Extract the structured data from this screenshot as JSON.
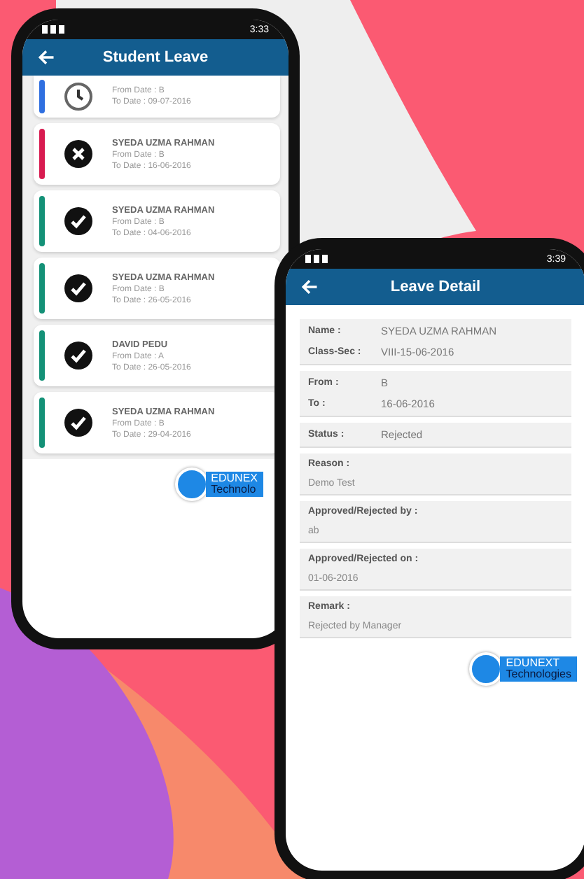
{
  "list_phone": {
    "status_time": "3:33",
    "title": "Student Leave",
    "leaves": [
      {
        "kind": "pending",
        "color": "#2f6fe0",
        "from_label": "From Date :",
        "from": "B",
        "to_label": "To Date :",
        "to": "09-07-2016"
      },
      {
        "kind": "rejected",
        "color": "#d81b50",
        "name": "SYEDA UZMA RAHMAN",
        "from_label": "From Date :",
        "from": "B",
        "to_label": "To Date :",
        "to": "16-06-2016"
      },
      {
        "kind": "approved",
        "color": "#149177",
        "name": "SYEDA UZMA RAHMAN",
        "from_label": "From Date :",
        "from": "B",
        "to_label": "To Date :",
        "to": "04-06-2016"
      },
      {
        "kind": "approved",
        "color": "#149177",
        "name": "SYEDA UZMA RAHMAN",
        "from_label": "From Date :",
        "from": "B",
        "to_label": "To Date :",
        "to": "26-05-2016"
      },
      {
        "kind": "approved",
        "color": "#149177",
        "name": "DAVID PEDU",
        "from_label": "From Date :",
        "from": "A",
        "to_label": "To Date :",
        "to": "26-05-2016"
      },
      {
        "kind": "approved",
        "color": "#149177",
        "name": "SYEDA UZMA RAHMAN",
        "from_label": "From Date :",
        "from": "B",
        "to_label": "To Date :",
        "to": "29-04-2016"
      }
    ],
    "logo": {
      "line1": "EDUNEX",
      "line2": "Technolo"
    }
  },
  "detail_phone": {
    "status_time": "3:39",
    "title": "Leave Detail",
    "sections": [
      {
        "kind": "inline",
        "fields": [
          {
            "label": "Name :",
            "value": "SYEDA UZMA RAHMAN"
          },
          {
            "label": "Class-Sec :",
            "value": "VIII-15-06-2016"
          }
        ]
      },
      {
        "kind": "inline",
        "fields": [
          {
            "label": "From :",
            "value": "B"
          },
          {
            "label": "To :",
            "value": "16-06-2016"
          }
        ]
      },
      {
        "kind": "inline",
        "fields": [
          {
            "label": "Status :",
            "value": "Rejected"
          }
        ]
      },
      {
        "kind": "stacked",
        "fields": [
          {
            "label": "Reason :",
            "value": "Demo Test"
          }
        ]
      },
      {
        "kind": "stacked",
        "fields": [
          {
            "label": "Approved/Rejected by :",
            "value": "ab"
          }
        ]
      },
      {
        "kind": "stacked",
        "fields": [
          {
            "label": "Approved/Rejected on :",
            "value": "01-06-2016"
          }
        ]
      },
      {
        "kind": "stacked",
        "fields": [
          {
            "label": "Remark :",
            "value": "Rejected by Manager"
          }
        ]
      }
    ],
    "logo": {
      "line1": "EDUNEXT",
      "line2": "Technologies"
    }
  }
}
